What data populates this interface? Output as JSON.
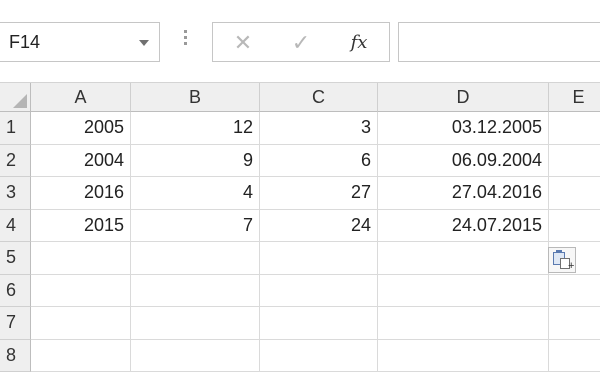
{
  "namebox": {
    "value": "F14"
  },
  "formula_bar": {
    "cancel": "✕",
    "enter": "✓",
    "fx": "fx",
    "value": ""
  },
  "columns": [
    "A",
    "B",
    "C",
    "D",
    "E"
  ],
  "rows": [
    {
      "num": "1",
      "cells": [
        "2005",
        "12",
        "3",
        "03.12.2005",
        ""
      ]
    },
    {
      "num": "2",
      "cells": [
        "2004",
        "9",
        "6",
        "06.09.2004",
        ""
      ]
    },
    {
      "num": "3",
      "cells": [
        "2016",
        "4",
        "27",
        "27.04.2016",
        ""
      ]
    },
    {
      "num": "4",
      "cells": [
        "2015",
        "7",
        "24",
        "24.07.2015",
        ""
      ]
    },
    {
      "num": "5",
      "cells": [
        "",
        "",
        "",
        "",
        ""
      ]
    },
    {
      "num": "6",
      "cells": [
        "",
        "",
        "",
        "",
        ""
      ]
    },
    {
      "num": "7",
      "cells": [
        "",
        "",
        "",
        "",
        ""
      ]
    },
    {
      "num": "8",
      "cells": [
        "",
        "",
        "",
        "",
        ""
      ]
    }
  ],
  "paste_options": {
    "icon": "paste-options-icon"
  }
}
